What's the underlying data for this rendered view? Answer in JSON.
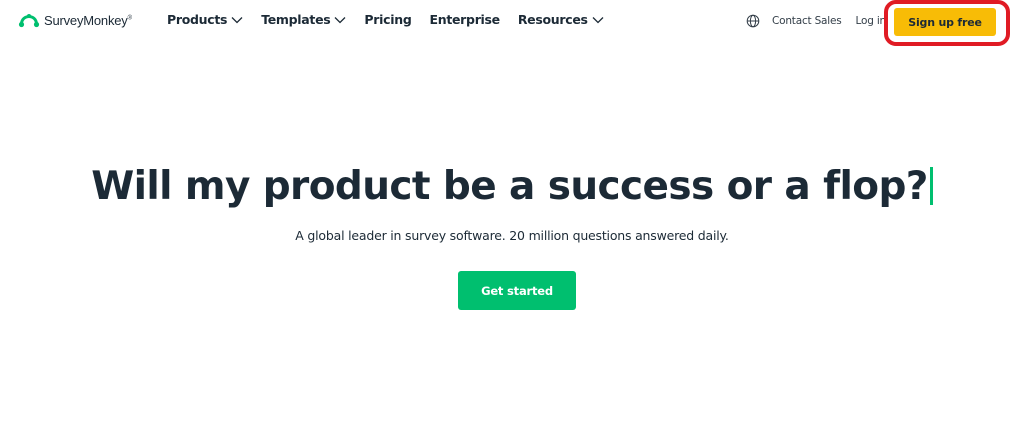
{
  "brand": {
    "name": "SurveyMonkey",
    "trademark": "®",
    "logo_icon": "monkey-logo-icon",
    "color": "#00bf6f"
  },
  "nav": {
    "items": [
      {
        "label": "Products",
        "has_dropdown": true
      },
      {
        "label": "Templates",
        "has_dropdown": true
      },
      {
        "label": "Pricing",
        "has_dropdown": false
      },
      {
        "label": "Enterprise",
        "has_dropdown": false
      },
      {
        "label": "Resources",
        "has_dropdown": true
      }
    ],
    "globe_icon": "globe-icon",
    "contact_sales": "Contact Sales",
    "login": "Log in",
    "signup": "Sign up free",
    "signup_color": "#f8bc06",
    "highlight_color": "#e01b24"
  },
  "hero": {
    "title": "Will my product be a success or a flop?",
    "subtitle": "A global leader in survey software. 20 million questions answered daily.",
    "cta": "Get started",
    "cta_color": "#00bf6f"
  }
}
